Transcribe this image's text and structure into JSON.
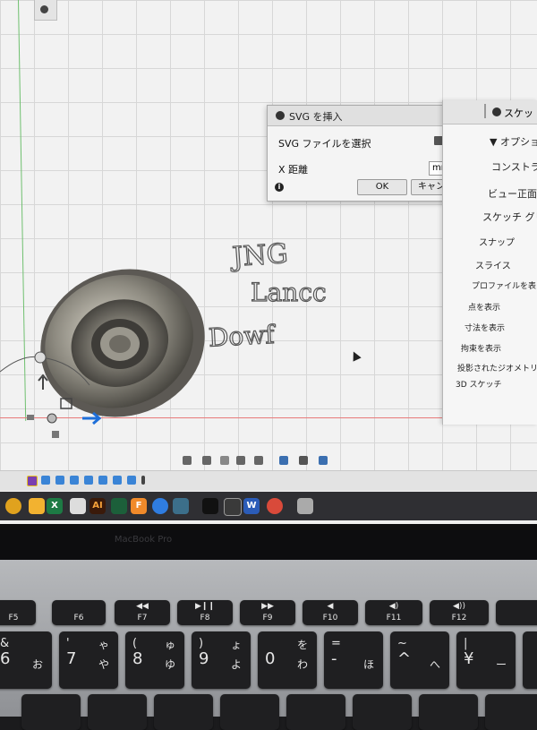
{
  "dialog": {
    "title": "SVG を挿入",
    "select_file_label": "SVG ファイルを選択",
    "x_distance_label": "X 距離",
    "unit_value": "mm",
    "ok_label": "OK",
    "cancel_label": "キャンセル"
  },
  "panel": {
    "title": "スケッ",
    "section": "オプショ",
    "items": [
      "コンストラ",
      "ビュー正面",
      "スケッチ グリ",
      "スナップ",
      "スライス",
      "プロファイルを表",
      "点を表示",
      "寸法を表示",
      "拘束を表示",
      "投影されたジオメトリ",
      "3D スケッチ"
    ]
  },
  "sketch_text": [
    "JNG",
    "Lancc",
    "Dowf"
  ],
  "dock": {
    "ai_label": "AI",
    "f_label": "F",
    "w_label": "W",
    "x_label": "X"
  },
  "laptop_label": "MacBook Pro",
  "keyboard": {
    "fn_keys": [
      "F5",
      "F6",
      "F7",
      "F8",
      "F9",
      "F10",
      "F11",
      "F12"
    ],
    "num_keys": [
      {
        "top": "&",
        "main": "6",
        "kana_top": "",
        "kana": "お"
      },
      {
        "top": "'",
        "main": "7",
        "kana_top": "ゃ",
        "kana": "や"
      },
      {
        "top": "(",
        "main": "8",
        "kana_top": "ゅ",
        "kana": "ゆ"
      },
      {
        "top": ")",
        "main": "9",
        "kana_top": "ょ",
        "kana": "よ"
      },
      {
        "top": "",
        "main": "0",
        "kana_top": "を",
        "kana": "わ"
      },
      {
        "top": "=",
        "main": "-",
        "kana_top": "",
        "kana": "ほ"
      },
      {
        "top": "~",
        "main": "^",
        "kana_top": "",
        "kana": "へ"
      },
      {
        "top": "|",
        "main": "¥",
        "kana_top": "",
        "kana": "ー"
      }
    ]
  },
  "colors": {
    "grid_bg": "#f2f2f2",
    "axis_red": "#e87a7a",
    "axis_green": "#6fc06f",
    "manipulator_blue": "#1e6fd9"
  }
}
